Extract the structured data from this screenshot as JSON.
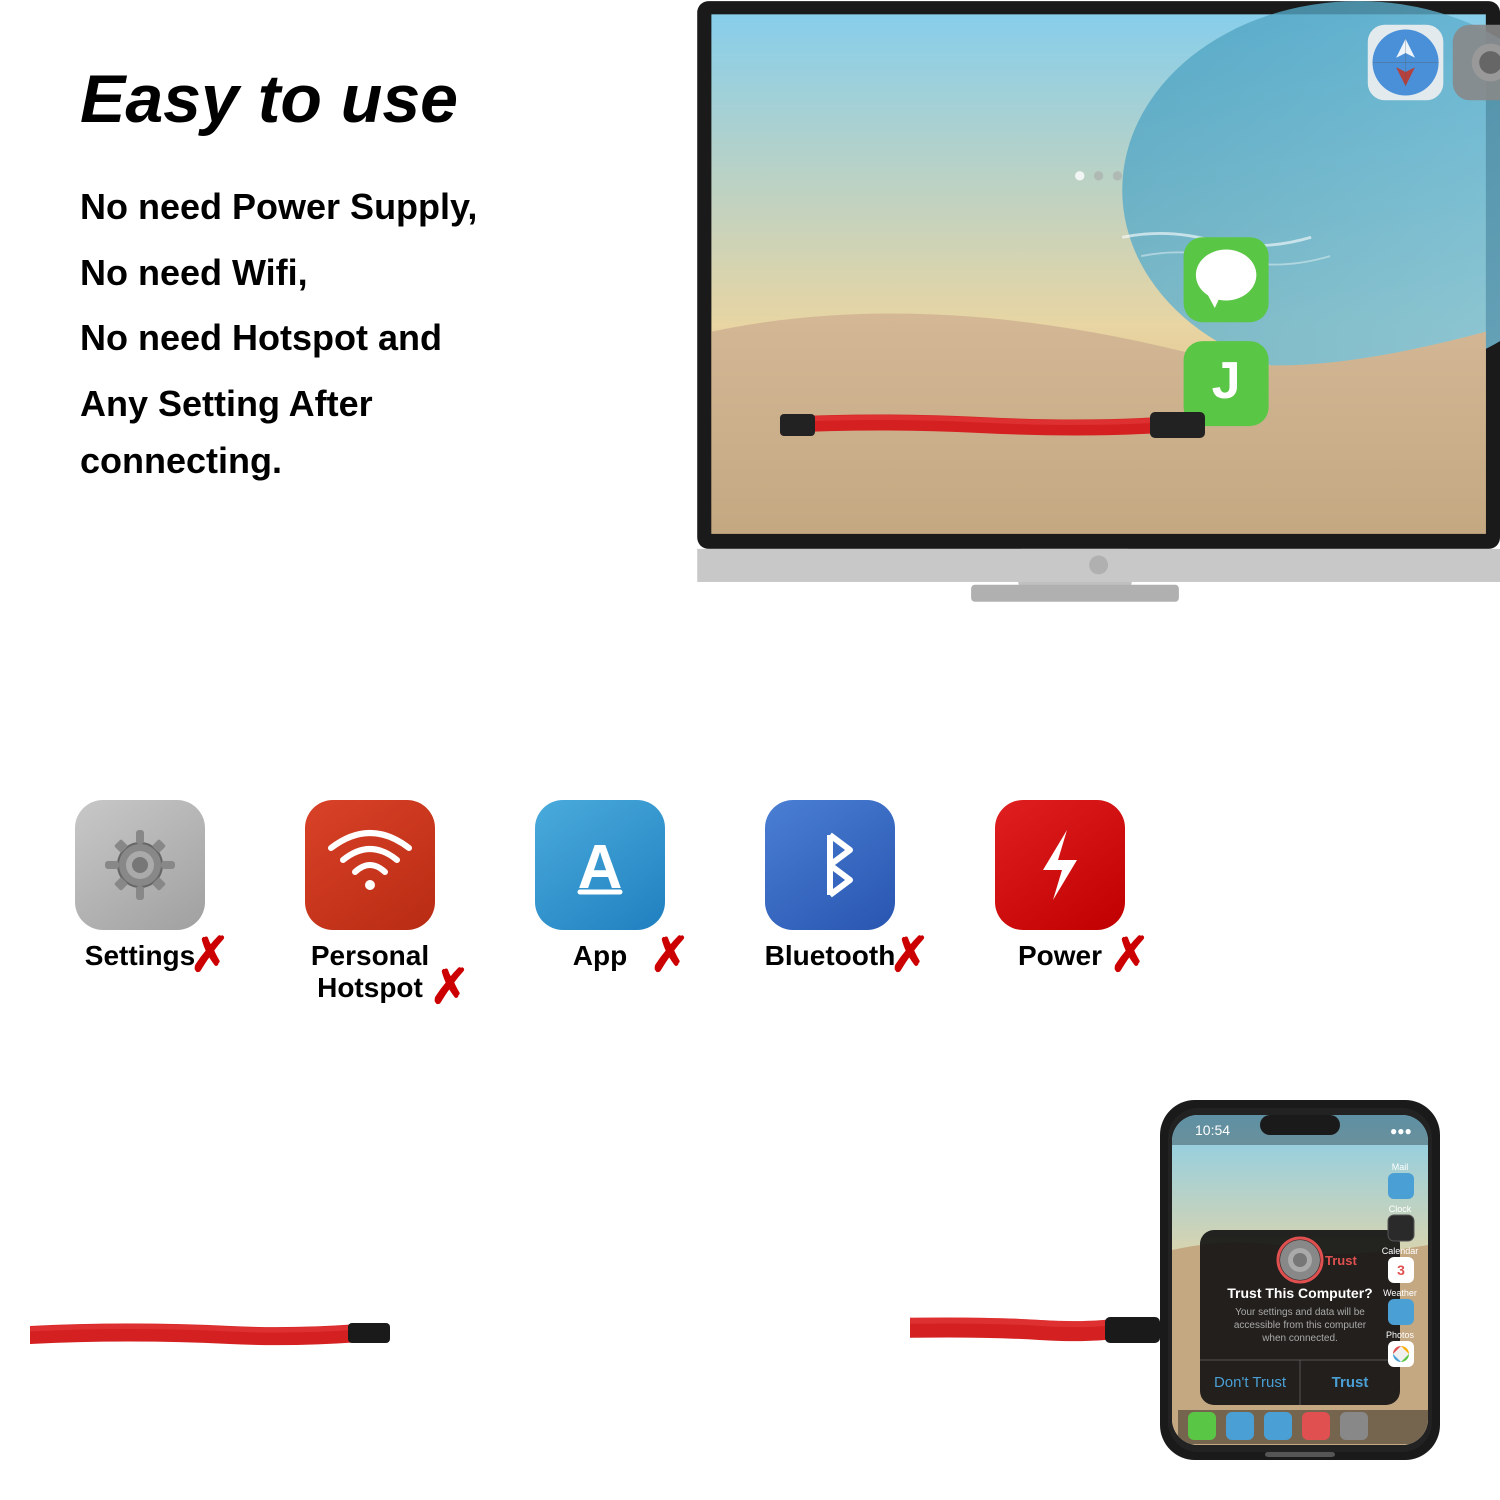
{
  "title": "Easy to use",
  "features": [
    "No need Power Supply,",
    "No need Wifi,",
    "No need Hotspot and",
    "Any Setting After connecting."
  ],
  "icons": [
    {
      "id": "settings",
      "label": "Settings",
      "color": "gray-bg",
      "symbol": "gear"
    },
    {
      "id": "personal-hotspot",
      "label": "Personal\nHotspot",
      "color": "red-bg",
      "symbol": "wifi"
    },
    {
      "id": "app-store",
      "label": "App",
      "color": "blue-bg",
      "symbol": "A"
    },
    {
      "id": "bluetooth",
      "label": "Bluetooth",
      "color": "dark-blue-bg",
      "symbol": "bt"
    },
    {
      "id": "power",
      "label": "Power",
      "color": "bright-red-bg",
      "symbol": "lightning"
    }
  ],
  "trust_dialog": {
    "title": "Trust This Computer?",
    "body": "Your settings and data will be accessible from this computer when connected.",
    "trust_btn": "Trust",
    "dont_trust_btn": "Don't Trust"
  }
}
